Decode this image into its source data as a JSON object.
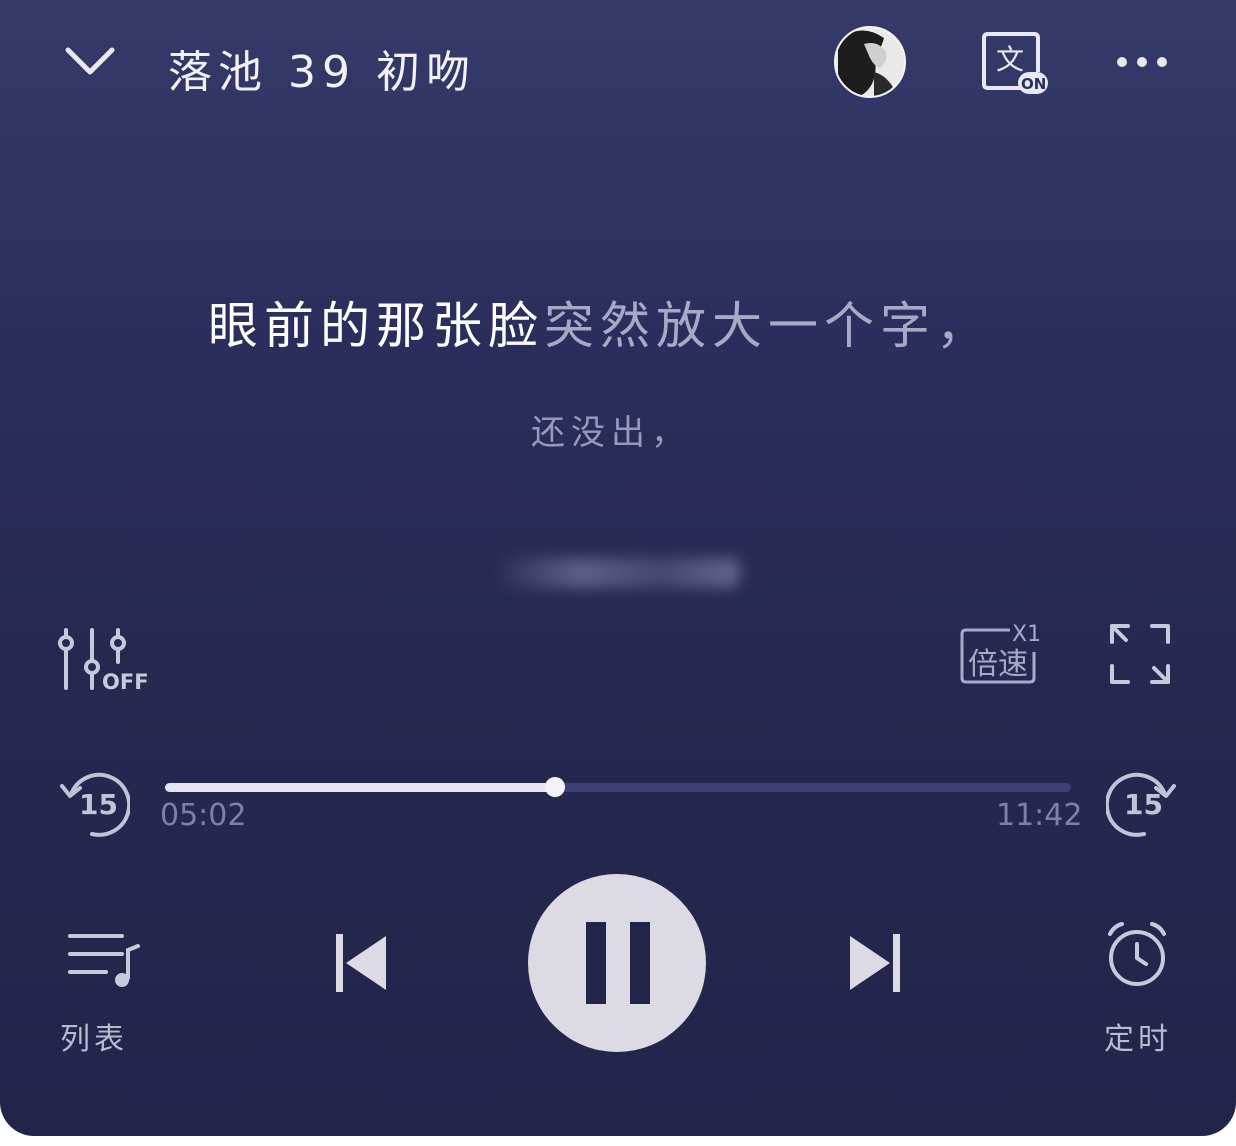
{
  "header": {
    "title": "落池  39  初吻",
    "translate_badge_glyph": "文",
    "translate_badge_state": "ON"
  },
  "lyrics": {
    "current_sung": "眼前的那张脸",
    "current_remaining": "突然放大一个字，",
    "next_line": "还没出，"
  },
  "controls": {
    "sound_effect_state": "OFF",
    "speed_label": "倍速",
    "speed_value": "X1",
    "rewind_seconds": "15",
    "forward_seconds": "15"
  },
  "progress": {
    "elapsed": "05:02",
    "total": "11:42",
    "fraction": 0.431
  },
  "bottom": {
    "playlist_label": "列表",
    "timer_label": "定时"
  },
  "colors": {
    "background_top": "#353a6a",
    "background_bottom": "#22244a",
    "accent_light": "#e5e5ef",
    "muted_text": "#7e80a4"
  }
}
